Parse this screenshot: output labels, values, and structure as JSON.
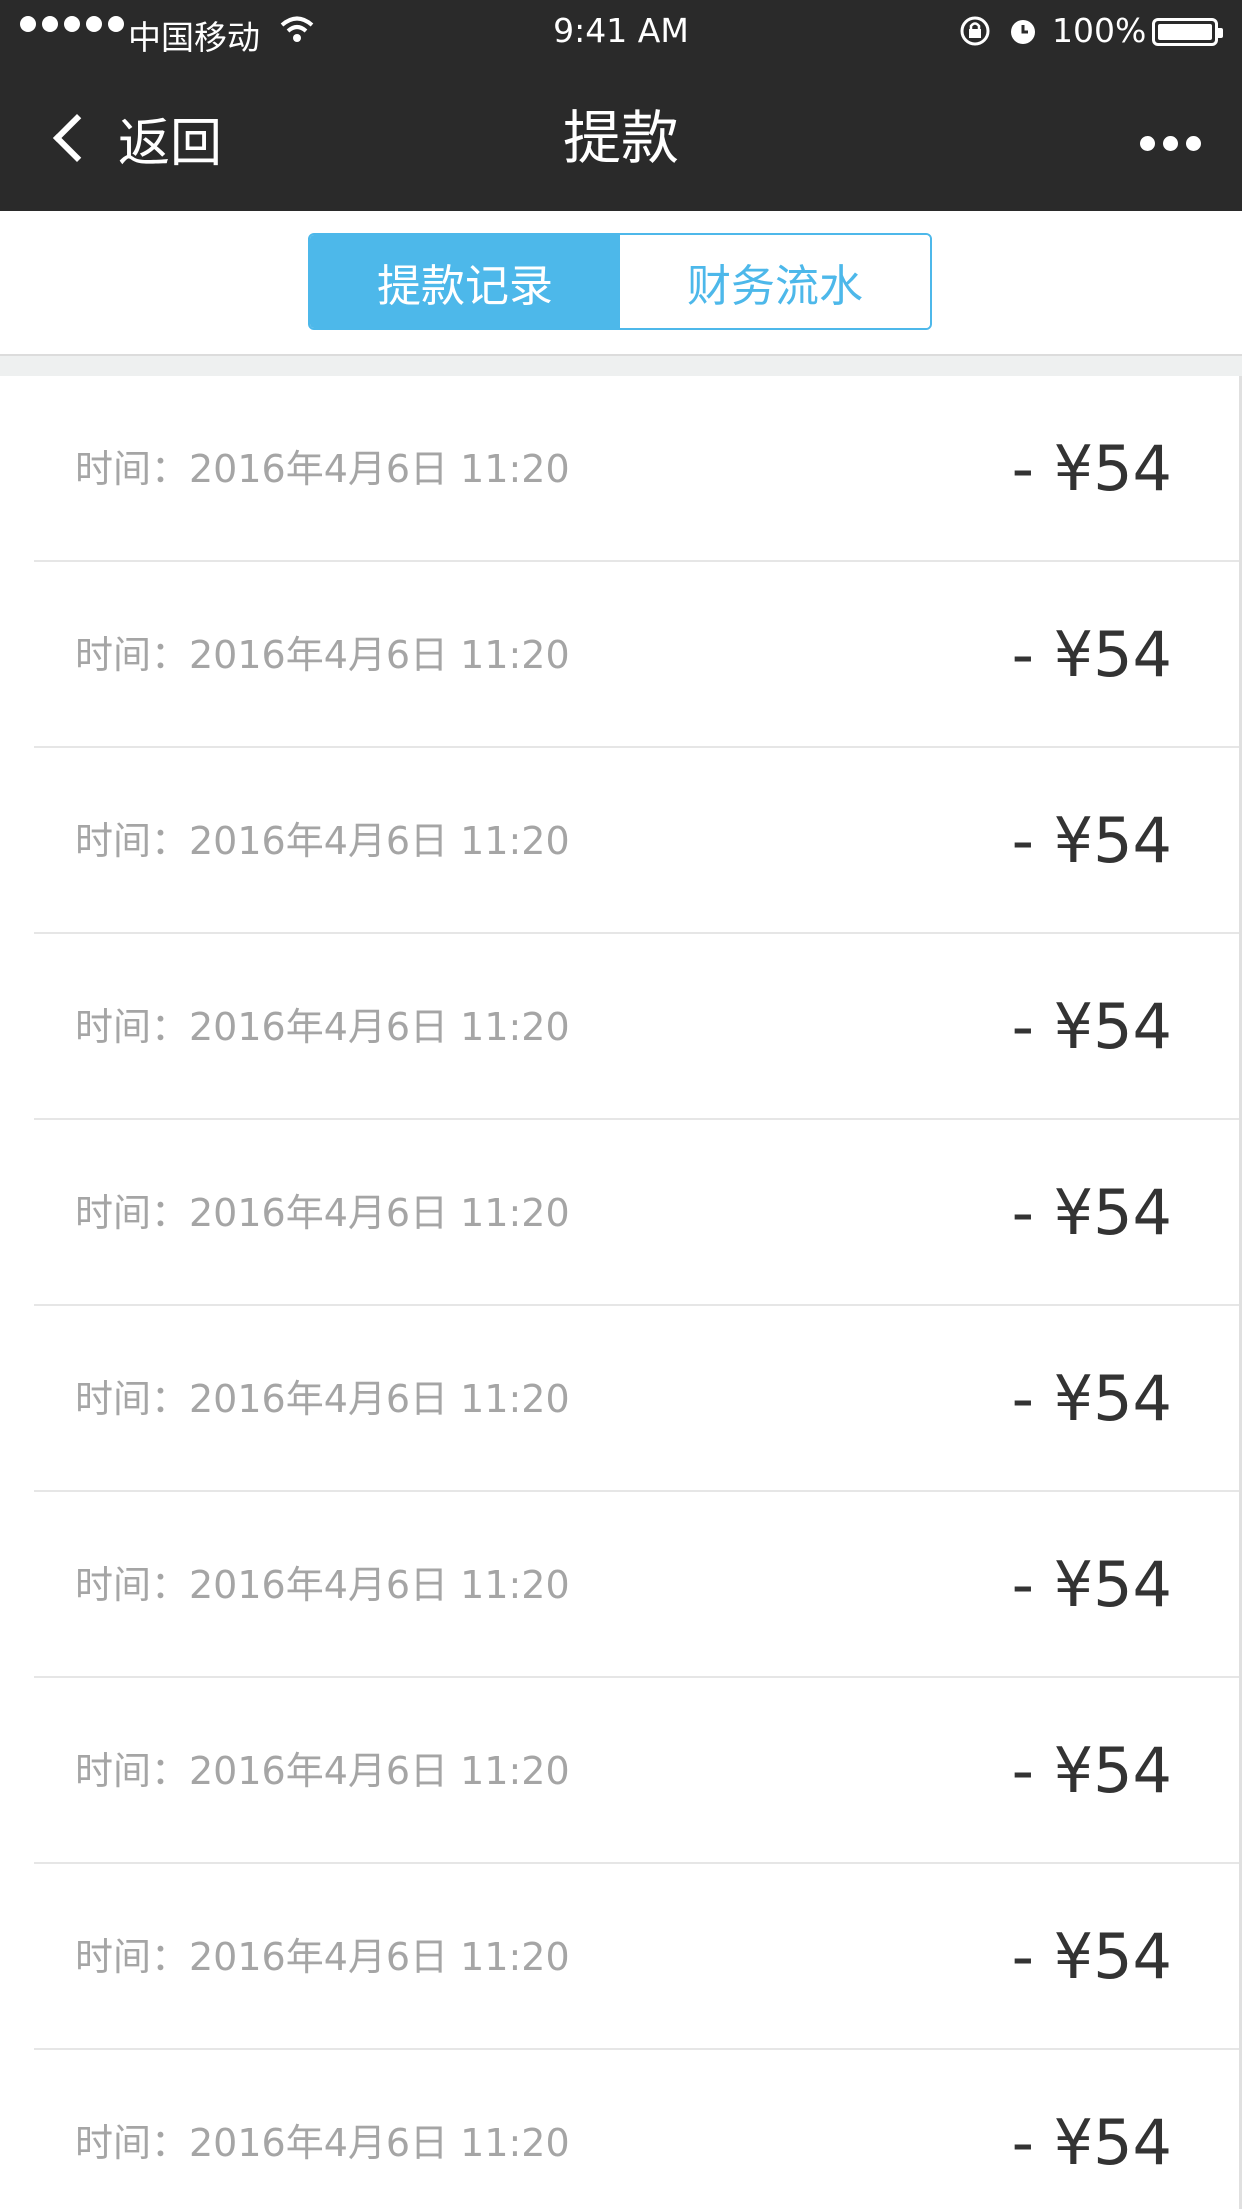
{
  "status_bar": {
    "carrier": "中国移动",
    "time": "9:41 AM",
    "battery_percent": "100%",
    "icons": [
      "signal-dots-icon",
      "wifi-icon",
      "rotation-lock-icon",
      "alarm-icon",
      "battery-icon"
    ]
  },
  "nav": {
    "back_label": "返回",
    "title": "提款",
    "more_icon": "more-dots-icon"
  },
  "tabs": [
    {
      "label": "提款记录",
      "active": true
    },
    {
      "label": "财务流水",
      "active": false
    }
  ],
  "records": [
    {
      "time": "时间：2016年4月6日 11:20",
      "amount": "- ¥54"
    },
    {
      "time": "时间：2016年4月6日 11:20",
      "amount": "- ¥54"
    },
    {
      "time": "时间：2016年4月6日 11:20",
      "amount": "- ¥54"
    },
    {
      "time": "时间：2016年4月6日 11:20",
      "amount": "- ¥54"
    },
    {
      "time": "时间：2016年4月6日 11:20",
      "amount": "- ¥54"
    },
    {
      "time": "时间：2016年4月6日 11:20",
      "amount": "- ¥54"
    },
    {
      "time": "时间：2016年4月6日 11:20",
      "amount": "- ¥54"
    },
    {
      "time": "时间：2016年4月6日 11:20",
      "amount": "- ¥54"
    },
    {
      "time": "时间：2016年4月6日 11:20",
      "amount": "- ¥54"
    },
    {
      "time": "时间：2016年4月6日 11:20",
      "amount": "- ¥54"
    }
  ],
  "colors": {
    "nav_bg": "#2a2a2a",
    "accent": "#4db8ea",
    "time_text": "#a5a5a5",
    "amount_text": "#333333"
  }
}
